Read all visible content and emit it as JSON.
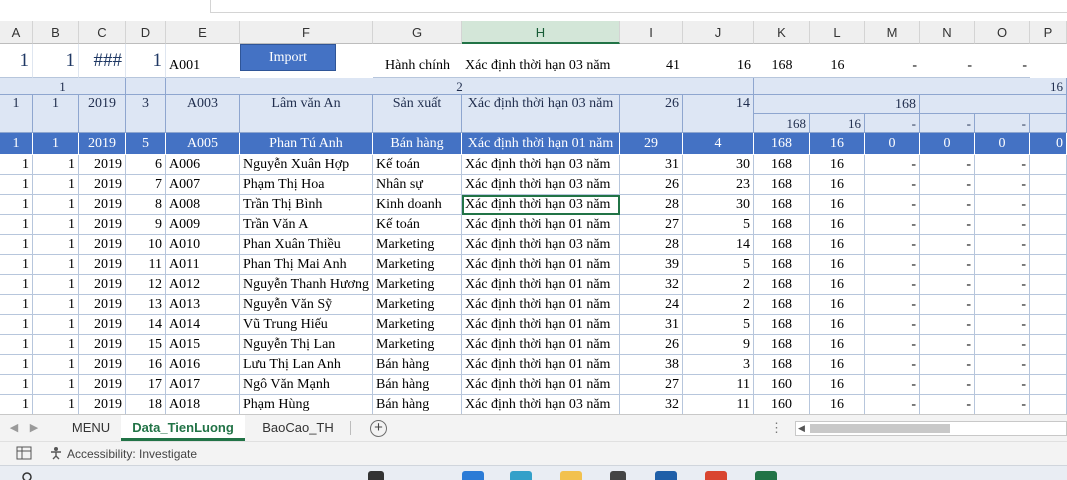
{
  "columns": [
    "A",
    "B",
    "C",
    "D",
    "E",
    "F",
    "G",
    "H",
    "I",
    "J",
    "K",
    "L",
    "M",
    "N",
    "O",
    "P"
  ],
  "selected_column": "H",
  "row1": {
    "a": "1",
    "b": "1",
    "c": "###",
    "d": "1",
    "e": "A001",
    "button": "Import",
    "g": "Hành chính",
    "h": "Xác định thời hạn 03 năm",
    "i": "41",
    "j": "16",
    "k": "168",
    "l": "16",
    "m": "-",
    "n": "-",
    "o": "-"
  },
  "row2": {
    "ab": "1",
    "cd": "2",
    "p": "16"
  },
  "row3": {
    "a": "1",
    "b": "1",
    "c": "2019",
    "d": "3",
    "e": "A003",
    "f": "Lâm văn An",
    "g": "Sản xuất",
    "h": "Xác định thời hạn 03 năm",
    "i": "26",
    "j": "14",
    "klm": "168"
  },
  "row4": {
    "k": "168",
    "l": "16",
    "m": "-",
    "n": "-",
    "o": "-"
  },
  "row5": {
    "a": "1",
    "b": "1",
    "c": "2019",
    "d": "5",
    "e": "A005",
    "f": "Phan Tú Anh",
    "g": "Bán hàng",
    "h": "Xác định thời hạn 01 năm",
    "i": "29",
    "j": "4",
    "k": "168",
    "l": "16",
    "m": "0",
    "n": "0",
    "o": "0",
    "p": "0"
  },
  "rows": [
    {
      "a": "1",
      "b": "1",
      "c": "2019",
      "d": "6",
      "e": "A006",
      "f": "Nguyễn Xuân Hợp",
      "g": "Kế toán",
      "h": "Xác định thời hạn 03 năm",
      "i": "31",
      "j": "30",
      "k": "168",
      "l": "16",
      "m": "-",
      "n": "-",
      "o": "-"
    },
    {
      "a": "1",
      "b": "1",
      "c": "2019",
      "d": "7",
      "e": "A007",
      "f": "Phạm Thị Hoa",
      "g": "Nhân sự",
      "h": "Xác định thời hạn 03 năm",
      "i": "26",
      "j": "23",
      "k": "168",
      "l": "16",
      "m": "-",
      "n": "-",
      "o": "-"
    },
    {
      "a": "1",
      "b": "1",
      "c": "2019",
      "d": "8",
      "e": "A008",
      "f": "Trần Thị Bình",
      "g": "Kinh doanh",
      "h": "Xác định thời hạn 03 năm",
      "i": "28",
      "j": "30",
      "k": "168",
      "l": "16",
      "m": "-",
      "n": "-",
      "o": "-"
    },
    {
      "a": "1",
      "b": "1",
      "c": "2019",
      "d": "9",
      "e": "A009",
      "f": "Trần Văn A",
      "g": "Kế toán",
      "h": "Xác định thời hạn 01 năm",
      "i": "27",
      "j": "5",
      "k": "168",
      "l": "16",
      "m": "-",
      "n": "-",
      "o": "-"
    },
    {
      "a": "1",
      "b": "1",
      "c": "2019",
      "d": "10",
      "e": "A010",
      "f": "Phan Xuân Thiều",
      "g": "Marketing",
      "h": "Xác định thời hạn 03 năm",
      "i": "28",
      "j": "14",
      "k": "168",
      "l": "16",
      "m": "-",
      "n": "-",
      "o": "-"
    },
    {
      "a": "1",
      "b": "1",
      "c": "2019",
      "d": "11",
      "e": "A011",
      "f": "Phan Thị Mai Anh",
      "g": "Marketing",
      "h": "Xác định thời hạn 01 năm",
      "i": "39",
      "j": "5",
      "k": "168",
      "l": "16",
      "m": "-",
      "n": "-",
      "o": "-"
    },
    {
      "a": "1",
      "b": "1",
      "c": "2019",
      "d": "12",
      "e": "A012",
      "f": "Nguyễn Thanh Hương",
      "g": "Marketing",
      "h": "Xác định thời hạn 01 năm",
      "i": "32",
      "j": "2",
      "k": "168",
      "l": "16",
      "m": "-",
      "n": "-",
      "o": "-"
    },
    {
      "a": "1",
      "b": "1",
      "c": "2019",
      "d": "13",
      "e": "A013",
      "f": "Nguyễn Văn Sỹ",
      "g": "Marketing",
      "h": "Xác định thời hạn 01 năm",
      "i": "24",
      "j": "2",
      "k": "168",
      "l": "16",
      "m": "-",
      "n": "-",
      "o": "-"
    },
    {
      "a": "1",
      "b": "1",
      "c": "2019",
      "d": "14",
      "e": "A014",
      "f": "Vũ Trung Hiếu",
      "g": "Marketing",
      "h": "Xác định thời hạn 01 năm",
      "i": "31",
      "j": "5",
      "k": "168",
      "l": "16",
      "m": "-",
      "n": "-",
      "o": "-"
    },
    {
      "a": "1",
      "b": "1",
      "c": "2019",
      "d": "15",
      "e": "A015",
      "f": "Nguyễn Thị Lan",
      "g": "Marketing",
      "h": "Xác định thời hạn 01 năm",
      "i": "26",
      "j": "9",
      "k": "168",
      "l": "16",
      "m": "-",
      "n": "-",
      "o": "-"
    },
    {
      "a": "1",
      "b": "1",
      "c": "2019",
      "d": "16",
      "e": "A016",
      "f": "Lưu Thị Lan Anh",
      "g": "Bán hàng",
      "h": "Xác định thời hạn 01 năm",
      "i": "38",
      "j": "3",
      "k": "168",
      "l": "16",
      "m": "-",
      "n": "-",
      "o": "-"
    },
    {
      "a": "1",
      "b": "1",
      "c": "2019",
      "d": "17",
      "e": "A017",
      "f": "Ngô Văn Mạnh",
      "g": "Bán hàng",
      "h": "Xác định thời hạn 01 năm",
      "i": "27",
      "j": "11",
      "k": "160",
      "l": "16",
      "m": "-",
      "n": "-",
      "o": "-"
    },
    {
      "a": "1",
      "b": "1",
      "c": "2019",
      "d": "18",
      "e": "A018",
      "f": "Phạm Hùng",
      "g": "Bán hàng",
      "h": "Xác định thời hạn 03 năm",
      "i": "32",
      "j": "11",
      "k": "160",
      "l": "16",
      "m": "-",
      "n": "-",
      "o": "-"
    }
  ],
  "sheet_tabs": [
    "MENU",
    "Data_TienLuong",
    "BaoCao_TH"
  ],
  "active_tab": "Data_TienLuong",
  "add_sheet": "+",
  "tab_overflow": "⋮",
  "status": {
    "accessibility": "Accessibility: Investigate"
  },
  "colors": {
    "accent_blue": "#4472c4",
    "excel_green": "#217346",
    "header_fill": "#dde6f4"
  }
}
